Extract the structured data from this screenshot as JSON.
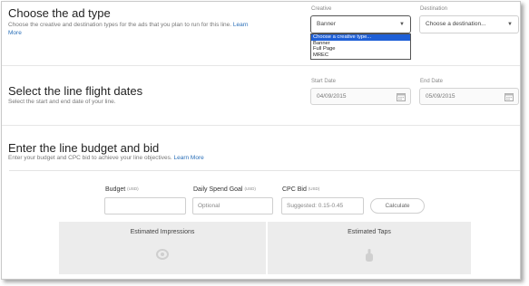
{
  "ad_type": {
    "title": "Choose the ad type",
    "description": "Choose the creative and destination types for the ads that you plan to run for this line.",
    "learn_more": "Learn More",
    "creative": {
      "label": "Creative",
      "value": "Banner",
      "options": [
        "Choose a creative type...",
        "Banner",
        "Full Page",
        "MREC"
      ]
    },
    "destination": {
      "label": "Destination",
      "value": "Choose a destination..."
    }
  },
  "flight_dates": {
    "title": "Select the line flight dates",
    "description": "Select the start and end date of your line.",
    "start": {
      "label": "Start Date",
      "value": "04/09/2015"
    },
    "end": {
      "label": "End Date",
      "value": "05/09/2015"
    }
  },
  "budget": {
    "title": "Enter the line budget and bid",
    "description": "Enter your budget and CPC bid to achieve your line objectives.",
    "learn_more": "Learn More",
    "budget_field": {
      "label": "Budget",
      "unit": "(USD)",
      "value": ""
    },
    "daily_goal": {
      "label": "Daily Spend Goal",
      "unit": "(USD)",
      "placeholder": "Optional"
    },
    "cpc_bid": {
      "label": "CPC Bid",
      "unit": "(USD)",
      "placeholder": "Suggested: 0.15-0.45"
    },
    "calculate_label": "Calculate",
    "estimated_impressions": "Estimated Impressions",
    "estimated_taps": "Estimated Taps"
  }
}
